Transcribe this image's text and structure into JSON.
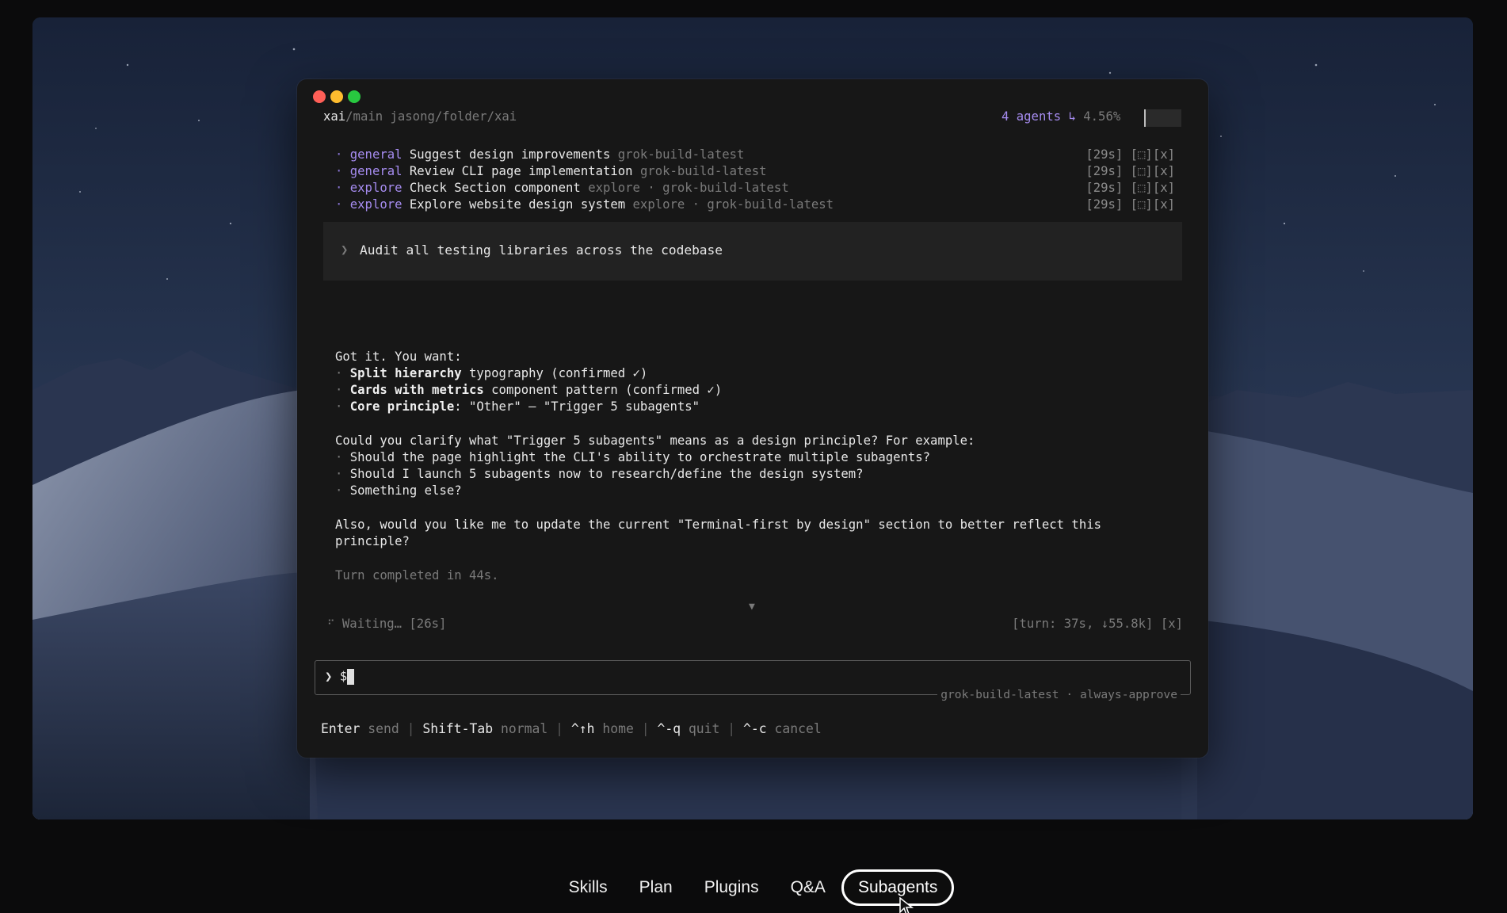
{
  "terminal": {
    "header": {
      "repo": "xai",
      "branch": "/main",
      "path": "jasong/folder/xai",
      "agents": "4 agents ↳",
      "context_pct": "4.56%"
    },
    "agents": [
      {
        "type": "general",
        "task": "Suggest design improvements",
        "meta": "grok-build-latest",
        "status": "[29s] [⬚][x]"
      },
      {
        "type": "general",
        "task": "Review CLI page implementation",
        "meta": "grok-build-latest",
        "status": "[29s] [⬚][x]"
      },
      {
        "type": "explore",
        "task": "Check Section component",
        "meta": "explore · grok-build-latest",
        "status": "[29s] [⬚][x]"
      },
      {
        "type": "explore",
        "task": "Explore website design system",
        "meta": "explore · grok-build-latest",
        "status": "[29s] [⬚][x]"
      }
    ],
    "user_prompt": {
      "marker": "❯",
      "text": "Audit all testing libraries across the codebase"
    },
    "response": {
      "intro": "Got it. You want:",
      "bullets": [
        {
          "bold": "Split hierarchy",
          "rest": " typography (confirmed ✓)"
        },
        {
          "bold": "Cards with metrics",
          "rest": " component pattern (confirmed ✓)"
        },
        {
          "bold": "Core principle",
          "rest": ": \"Other\" — \"Trigger 5 subagents\""
        }
      ],
      "question": "Could you clarify what \"Trigger 5 subagents\" means as a design principle? For example:",
      "options": [
        "Should the page highlight the CLI's ability to orchestrate multiple subagents?",
        "Should I launch 5 subagents now to research/define the design system?",
        "Something else?"
      ],
      "followup_1": "Also, would you like me to update the current \"Terminal-first by design\" section to better reflect this",
      "followup_2": "principle?",
      "turn_completed": "Turn completed in 44s."
    },
    "scroll_indicator": "▼",
    "status": {
      "spinner": "⠋",
      "waiting": "Waiting… [26s]",
      "turn_info": "[turn: 37s, ↓55.8k] [x]"
    },
    "input": {
      "prefix": "❯ $",
      "model": "grok-build-latest",
      "sep": "·",
      "mode": "always-approve"
    },
    "hints": [
      {
        "key": "Enter",
        "action": "send"
      },
      {
        "key": "Shift-Tab",
        "action": "normal"
      },
      {
        "key": "^↑h",
        "action": "home"
      },
      {
        "key": "^-q",
        "action": "quit"
      },
      {
        "key": "^-c",
        "action": "cancel"
      }
    ],
    "hint_sep": "|"
  },
  "nav": {
    "tabs": [
      "Skills",
      "Plan",
      "Plugins",
      "Q&A",
      "Subagents"
    ],
    "active": "Subagents"
  },
  "colors": {
    "accent_purple": "#a68cf0",
    "terminal_bg": "#171717"
  }
}
